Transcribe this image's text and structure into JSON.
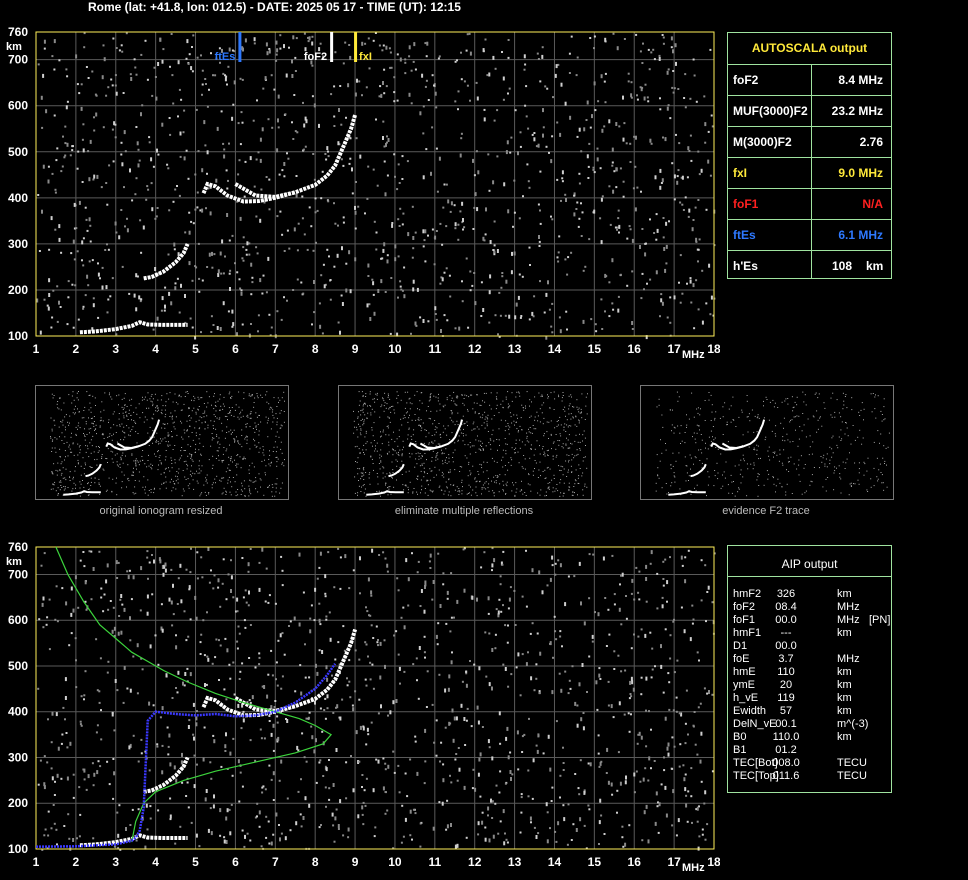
{
  "header": {
    "text": "Rome (lat: +41.8, lon: 012.5) - DATE: 2025 05 17 - TIME (UT): 12:15"
  },
  "colors": {
    "border": "#ffef5a",
    "grid": "#5a5a5a",
    "trace": "#ffffff",
    "green": "#3cd43c",
    "blue": "#3a38ff",
    "ftEs": "#2e79ff",
    "fxI": "#ffe93a",
    "foF1": "#ff2020",
    "panelBorder": "#9fe39f"
  },
  "chart_data": [
    {
      "type": "scatter",
      "name": "top-ionogram",
      "xlabel": "MHz",
      "ylabel": "km",
      "xlim": [
        1,
        18
      ],
      "ylim": [
        100,
        760
      ],
      "xticks": [
        "1",
        "2",
        "3",
        "4",
        "5",
        "6",
        "7",
        "8",
        "9",
        "10",
        "11",
        "12",
        "13",
        "14",
        "15",
        "16",
        "17",
        "18"
      ],
      "yticks": [
        "100",
        "200",
        "300",
        "400",
        "500",
        "600",
        "700",
        "760"
      ],
      "markers": [
        {
          "label": "ftEs",
          "x": 6.1,
          "color": "#2e79ff"
        },
        {
          "label": "foF2",
          "x": 8.4,
          "color": "#ffffff"
        },
        {
          "label": "fxI",
          "x": 9.0,
          "color": "#ffe93a"
        }
      ],
      "traces": {
        "Es": [
          [
            2.1,
            108
          ],
          [
            2.5,
            110
          ],
          [
            3.0,
            115
          ],
          [
            3.4,
            122
          ],
          [
            3.6,
            130
          ],
          [
            3.8,
            125
          ],
          [
            4.2,
            124
          ],
          [
            4.8,
            124
          ]
        ],
        "E_spread": [
          [
            3.7,
            225
          ],
          [
            3.9,
            228
          ],
          [
            4.2,
            240
          ],
          [
            4.5,
            260
          ],
          [
            4.7,
            280
          ],
          [
            4.8,
            300
          ]
        ],
        "F2": [
          [
            5.2,
            410
          ],
          [
            5.3,
            430
          ],
          [
            5.5,
            425
          ],
          [
            5.8,
            405
          ],
          [
            6.2,
            392
          ],
          [
            6.6,
            393
          ],
          [
            7.0,
            400
          ],
          [
            7.5,
            412
          ],
          [
            8.0,
            428
          ],
          [
            8.3,
            448
          ],
          [
            8.5,
            470
          ],
          [
            8.7,
            510
          ],
          [
            8.9,
            550
          ],
          [
            9.0,
            580
          ]
        ],
        "F2_upper": [
          [
            6.0,
            430
          ],
          [
            6.5,
            405
          ],
          [
            7.0,
            402
          ],
          [
            7.5,
            412
          ]
        ]
      }
    },
    {
      "type": "line",
      "name": "bottom-ionogram",
      "xlabel": "MHz",
      "ylabel": "km",
      "xlim": [
        1,
        18
      ],
      "ylim": [
        100,
        760
      ],
      "xticks": [
        "1",
        "2",
        "3",
        "4",
        "5",
        "6",
        "7",
        "8",
        "9",
        "10",
        "11",
        "12",
        "13",
        "14",
        "15",
        "16",
        "17",
        "18"
      ],
      "yticks": [
        "100",
        "200",
        "300",
        "400",
        "500",
        "600",
        "700",
        "760"
      ],
      "series": [
        {
          "color": "#3cd43c",
          "x": [
            1.5,
            1.8,
            2.2,
            2.6,
            3.0,
            3.4,
            3.8,
            4.2,
            4.8,
            5.5,
            6.2,
            7.0,
            7.6,
            8.0,
            8.4,
            8.2,
            7.5,
            6.5,
            5.5,
            4.7,
            4.0,
            3.7,
            3.5,
            3.4
          ],
          "y": [
            760,
            700,
            640,
            590,
            560,
            530,
            510,
            490,
            465,
            440,
            420,
            400,
            385,
            370,
            350,
            330,
            310,
            290,
            270,
            250,
            225,
            200,
            160,
            115
          ]
        },
        {
          "color": "#3a38ff",
          "x": [
            1.0,
            2.0,
            3.0,
            3.4,
            3.5,
            3.6,
            3.7,
            3.8,
            4.0,
            4.5,
            5.0,
            5.5,
            6.0,
            6.5,
            7.0,
            7.5,
            8.0,
            8.3,
            8.5
          ],
          "y": [
            105,
            106,
            110,
            118,
            125,
            140,
            190,
            380,
            400,
            395,
            392,
            395,
            390,
            392,
            400,
            420,
            450,
            480,
            505
          ]
        }
      ]
    }
  ],
  "autoscala": {
    "title": "AUTOSCALA output",
    "rows": [
      {
        "label": "foF2",
        "value": "8.4 MHz",
        "color": "#ffffff"
      },
      {
        "label": "MUF(3000)F2",
        "value": "23.2 MHz",
        "color": "#ffffff"
      },
      {
        "label": "M(3000)F2",
        "value": "2.76",
        "color": "#ffffff"
      },
      {
        "label": "fxI",
        "value": "9.0 MHz",
        "color": "#ffe93a"
      },
      {
        "label": "foF1",
        "value": "N/A",
        "color": "#ff2020"
      },
      {
        "label": "ftEs",
        "value": "6.1 MHz",
        "color": "#2e79ff"
      },
      {
        "label": "h'Es",
        "value": "108",
        "unit": "km",
        "color": "#ffffff"
      }
    ]
  },
  "aip": {
    "title": "AIP output",
    "rows": [
      {
        "name": "hmF2",
        "value": "326",
        "unit": "km",
        "extra": ""
      },
      {
        "name": "foF2",
        "value": "08.4",
        "unit": "MHz",
        "extra": ""
      },
      {
        "name": "foF1",
        "value": "00.0",
        "unit": "MHz",
        "extra": "[PN]"
      },
      {
        "name": "hmF1",
        "value": "---",
        "unit": "km",
        "extra": ""
      },
      {
        "name": "D1",
        "value": "00.0",
        "unit": "",
        "extra": ""
      },
      {
        "name": "foE",
        "value": "3.7",
        "unit": "MHz",
        "extra": ""
      },
      {
        "name": "hmE",
        "value": "110",
        "unit": "km",
        "extra": ""
      },
      {
        "name": "ymE",
        "value": "20",
        "unit": "km",
        "extra": ""
      },
      {
        "name": "h_vE",
        "value": "119",
        "unit": "km",
        "extra": ""
      },
      {
        "name": "Ewidth",
        "value": "57",
        "unit": "km",
        "extra": ""
      },
      {
        "name": "DelN_vE",
        "value": "00.1",
        "unit": "m^(-3)",
        "extra": ""
      },
      {
        "name": "B0",
        "value": "110.0",
        "unit": "km",
        "extra": ""
      },
      {
        "name": "B1",
        "value": "01.2",
        "unit": "",
        "extra": ""
      },
      {
        "name": "TEC[Bot]",
        "value": "008.0",
        "unit": "TECU",
        "extra": ""
      },
      {
        "name": "TEC[Top]",
        "value": "011.6",
        "unit": "TECU",
        "extra": ""
      }
    ]
  },
  "thumbnails": [
    {
      "caption": "original ionogram resized"
    },
    {
      "caption": "eliminate multiple reflections"
    },
    {
      "caption": "evidence F2 trace"
    }
  ]
}
